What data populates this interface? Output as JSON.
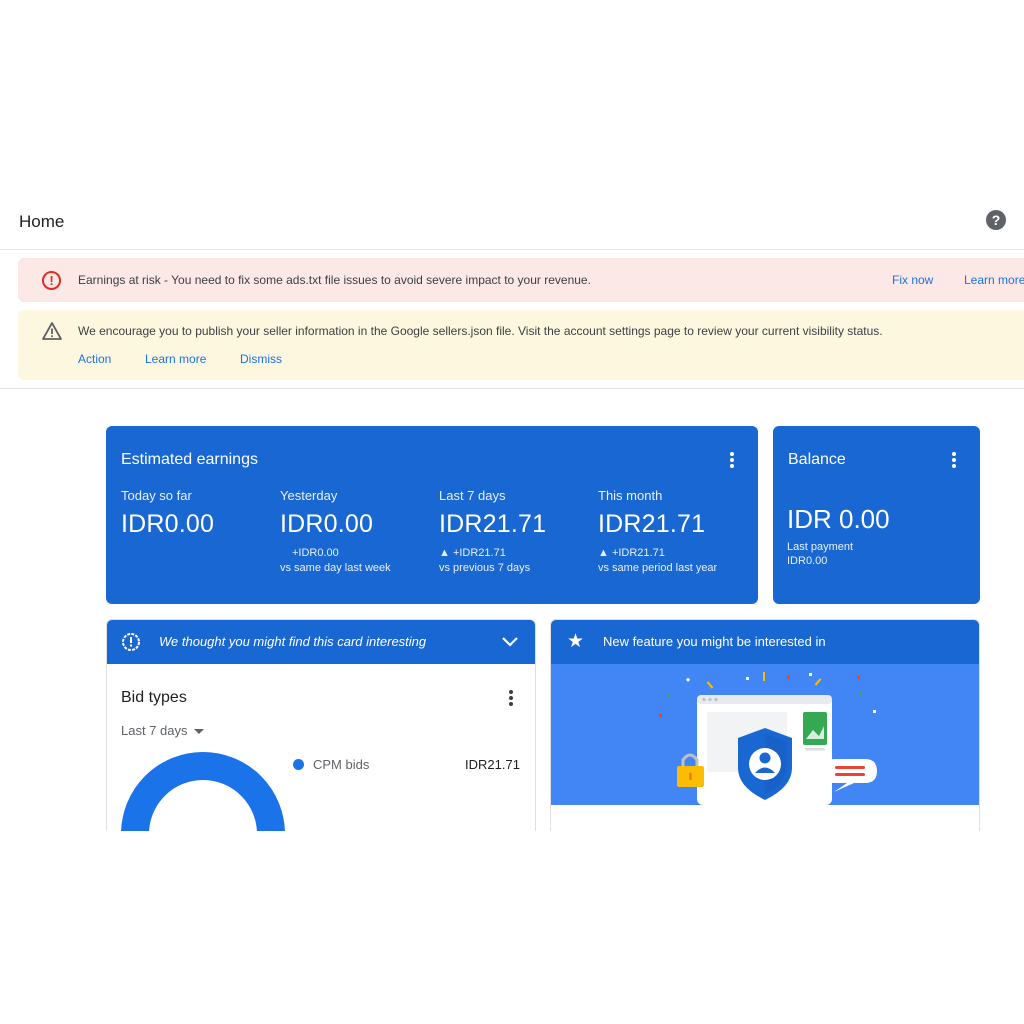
{
  "header": {
    "title": "Home",
    "help_icon": "help-icon"
  },
  "alerts": {
    "error": {
      "icon": "error-icon",
      "message": "Earnings at risk - You need to fix some ads.txt file issues to avoid severe impact to your revenue.",
      "fix_label": "Fix now",
      "learn_label": "Learn more"
    },
    "warning": {
      "icon": "warning-icon",
      "message": "We encourage you to publish your seller information in the Google sellers.json file. Visit the account settings page to review your current visibility status.",
      "action_label": "Action",
      "learn_label": "Learn more",
      "dismiss_label": "Dismiss"
    }
  },
  "earnings": {
    "title": "Estimated earnings",
    "metrics": [
      {
        "label": "Today so far",
        "value": "IDR0.00",
        "change": "",
        "compare": ""
      },
      {
        "label": "Yesterday",
        "value": "IDR0.00",
        "change": "+IDR0.00",
        "compare": "vs same day last week"
      },
      {
        "label": "Last 7 days",
        "value": "IDR21.71",
        "change": "▲ +IDR21.71",
        "compare": "vs previous 7 days"
      },
      {
        "label": "This month",
        "value": "IDR21.71",
        "change": "▲ +IDR21.71",
        "compare": "vs same period last year"
      }
    ]
  },
  "balance": {
    "title": "Balance",
    "value": "IDR 0.00",
    "last_payment_label": "Last payment",
    "last_payment_value": "IDR0.00"
  },
  "tip_card": {
    "header": "We thought you might find this card interesting",
    "title": "Bid types",
    "range": "Last 7 days",
    "legend": [
      {
        "name": "CPM bids",
        "value": "IDR21.71"
      }
    ]
  },
  "chart_data": {
    "type": "pie",
    "categories": [
      "CPM bids"
    ],
    "values": [
      21.71
    ]
  },
  "feature_card": {
    "header": "New feature you might be interested in",
    "icon": "star-icon"
  },
  "colors": {
    "primary_blue": "#1967d2",
    "illustration_blue": "#4285f4",
    "error_red": "#d93025",
    "error_bg": "#fce8e6",
    "warning_bg": "#fef7e0",
    "link_blue": "#1a73e8"
  }
}
